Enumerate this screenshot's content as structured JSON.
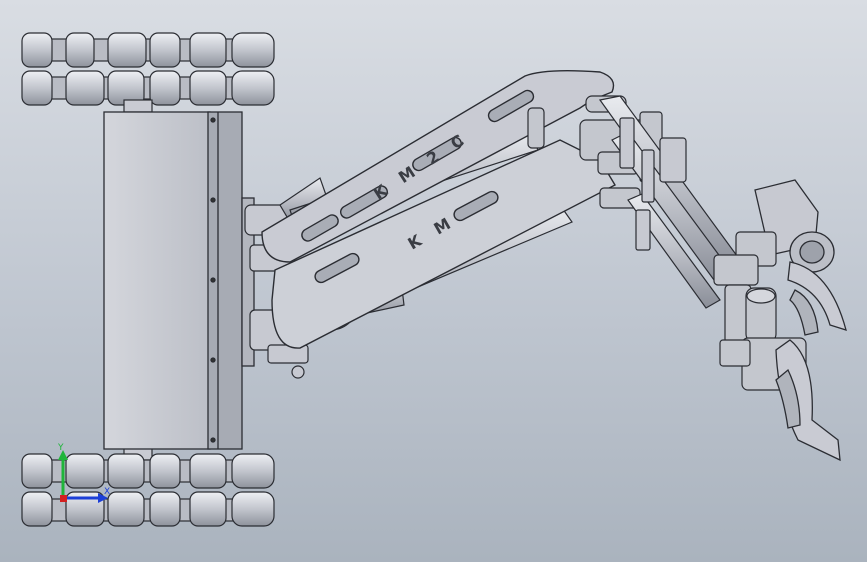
{
  "viewport": {
    "background_top": "#d9dde3",
    "background_bottom": "#aab3be"
  },
  "model": {
    "engraving_text": "K M 2 C",
    "engraving_partial_text": "K M",
    "part_color": "#c9cbd3",
    "edge_color": "#2b2d33"
  },
  "triad": {
    "x_label": "X",
    "y_label": "Y",
    "x_color": "#1c3fd8",
    "y_color": "#1fb53a",
    "z_color": "#d42020"
  }
}
